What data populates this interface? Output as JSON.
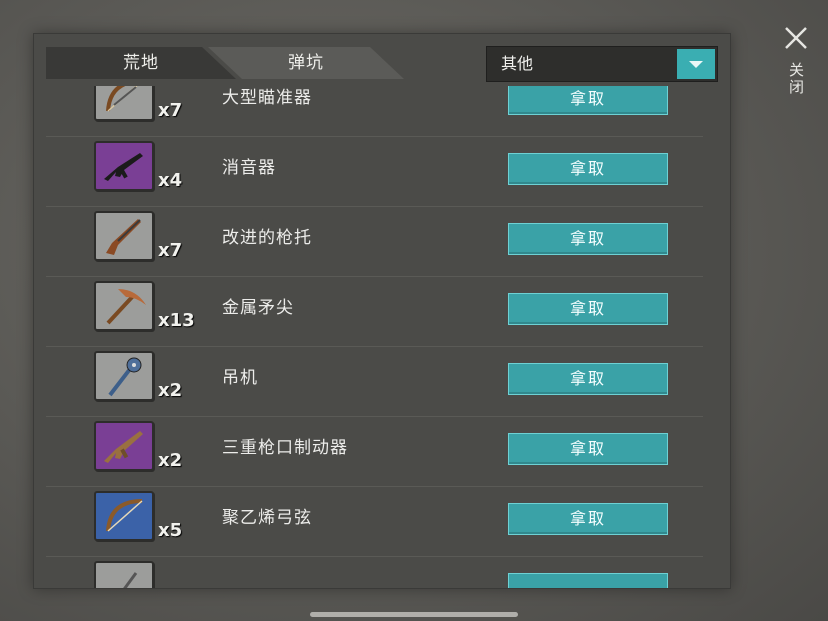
{
  "tabs": [
    {
      "label": "荒地"
    },
    {
      "label": "弹坑"
    }
  ],
  "dropdown": {
    "selected": "其他"
  },
  "close": {
    "label": "关闭"
  },
  "colors": {
    "accent": "#3aa2a7",
    "panel": "#4b4b48",
    "rarity_gray": "#9c9d9b",
    "rarity_purple": "#7a3f95",
    "rarity_blue": "#3b62a8"
  },
  "items": [
    {
      "name": "大型瞄准器",
      "qty": "x7",
      "button": "拿取",
      "rarity": "gray",
      "icon": "bow-icon"
    },
    {
      "name": "消音器",
      "qty": "x4",
      "button": "拿取",
      "rarity": "purple",
      "icon": "rifle-icon"
    },
    {
      "name": "改进的枪托",
      "qty": "x7",
      "button": "拿取",
      "rarity": "gray",
      "icon": "shotgun-icon"
    },
    {
      "name": "金属矛尖",
      "qty": "x13",
      "button": "拿取",
      "rarity": "gray",
      "icon": "pickaxe-icon"
    },
    {
      "name": "吊机",
      "qty": "x2",
      "button": "拿取",
      "rarity": "gray",
      "icon": "spiked-club-icon"
    },
    {
      "name": "三重枪口制动器",
      "qty": "x2",
      "button": "拿取",
      "rarity": "purple",
      "icon": "assault-rifle-icon"
    },
    {
      "name": "聚乙烯弓弦",
      "qty": "x5",
      "button": "拿取",
      "rarity": "blue",
      "icon": "bow-icon"
    },
    {
      "name": "",
      "qty": "",
      "button": "",
      "rarity": "gray",
      "icon": "partial-item-icon"
    }
  ]
}
